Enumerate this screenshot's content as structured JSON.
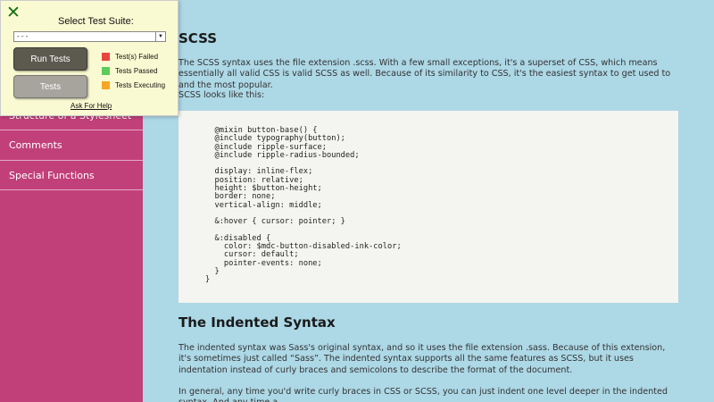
{
  "sidebar": {
    "items": [
      {
        "label": "Structure of a Stylesheet"
      },
      {
        "label": "Comments"
      },
      {
        "label": "Special Functions"
      }
    ]
  },
  "main": {
    "scss_heading": "SCSS",
    "scss_para": "The SCSS syntax uses the file extension .scss. With a few small exceptions, it's a superset of CSS, which means essentially all valid CSS is valid SCSS as well. Because of its similarity to CSS, it's the easiest syntax to get used to and the most popular.",
    "scss_looks": "SCSS looks like this:",
    "code": "  @mixin button-base() {\n  @include typography(button);\n  @include ripple-surface;\n  @include ripple-radius-bounded;\n\n  display: inline-flex;\n  position: relative;\n  height: $button-height;\n  border: none;\n  vertical-align: middle;\n\n  &:hover { cursor: pointer; }\n\n  &:disabled {\n    color: $mdc-button-disabled-ink-color;\n    cursor: default;\n    pointer-events: none;\n  }\n}",
    "indented_heading": "The Indented Syntax",
    "indented_para": "The indented syntax was Sass's original syntax, and so it uses the file extension .sass. Because of this extension, it's sometimes just called “Sass”. The indented syntax supports all the same features as SCSS, but it uses indentation instead of curly braces and semicolons to describe the format of the document.",
    "indented_para2": "In general, any time you'd write curly braces in CSS or SCSS, you can just indent one level deeper in the indented syntax. And any time a"
  },
  "test_panel": {
    "close_glyph": "✕",
    "title": "Select Test Suite:",
    "selected": "- - -",
    "run_label": "Run Tests",
    "tests_label": "Tests",
    "legend": [
      {
        "label": "Test(s) Failed",
        "color": "#e8453c"
      },
      {
        "label": "Tests Passed",
        "color": "#5ccc5c"
      },
      {
        "label": "Tests Executing",
        "color": "#f5a623"
      }
    ],
    "help_label": "Ask For Help"
  },
  "colors": {
    "background": "#add8e6",
    "sidebar": "#c2407a",
    "panel": "#fafad2"
  }
}
